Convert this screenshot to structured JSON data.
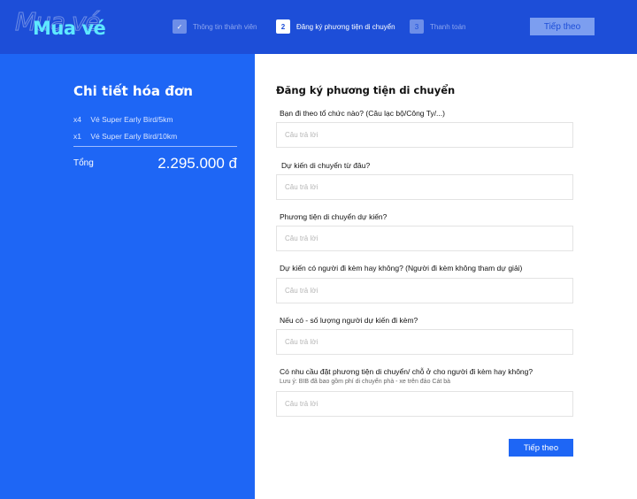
{
  "header": {
    "logo_text": "Mua vé",
    "steps": [
      {
        "label": "Thông tin thành viên",
        "marker": "✓",
        "state": "done"
      },
      {
        "label": "Đăng ký phương tiện di chuyển",
        "marker": "2",
        "state": "active"
      },
      {
        "label": "Thanh toán",
        "marker": "3",
        "state": "todo"
      }
    ],
    "next_label": "Tiếp theo"
  },
  "invoice": {
    "title": "Chi tiết hóa đơn",
    "items": [
      {
        "qty": "x4",
        "name": "Vé Super Early Bird/5km"
      },
      {
        "qty": "x1",
        "name": "Vé Super Early Bird/10km"
      }
    ],
    "total_label": "Tổng",
    "total_value": "2.295.000 đ"
  },
  "form": {
    "title": "Đăng ký phương tiện di chuyển",
    "placeholder": "Câu trả lời",
    "questions": [
      {
        "label": "Bạn đi theo tổ chức nào? (Câu lạc bộ/Công Ty/...)"
      },
      {
        "label": "Dự kiến di chuyển từ đâu?"
      },
      {
        "label": "Phương tiện di chuyển dự kiến?"
      },
      {
        "label": "Dự kiến có người đi kèm hay không? (Người đi kèm không tham dự giải)"
      },
      {
        "label": "Nếu có - số lượng người dự kiến đi kèm?"
      },
      {
        "label": "Có nhu cầu đặt phương tiện di chuyển/ chỗ ở cho người đi kèm hay không?",
        "note": "Lưu ý: BIB đã bao gồm phí di chuyển phà - xe trên đảo Cát bà"
      }
    ],
    "submit_label": "Tiếp theo"
  },
  "colors": {
    "header_bg": "#1d4ed8",
    "panel_bg": "#1e66f5",
    "logo_accent": "#5ee8ff",
    "button_bg": "#1e66f5"
  }
}
